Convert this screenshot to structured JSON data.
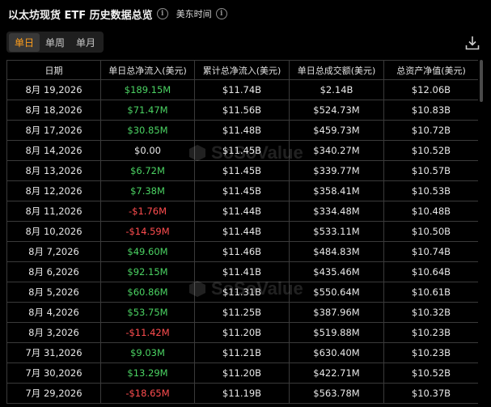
{
  "header": {
    "title": "以太坊现货 ETF 历史数据总览",
    "timezone_label": "美东时间"
  },
  "tabs": [
    {
      "label": "单日",
      "active": true
    },
    {
      "label": "单周",
      "active": false
    },
    {
      "label": "单月",
      "active": false
    }
  ],
  "watermark_text": "SoSoValue",
  "colors": {
    "accent": "#ff9f1c",
    "positive": "#4bd363",
    "negative": "#ff4d4f"
  },
  "table": {
    "columns": [
      "日期",
      "单日总净流入(美元)",
      "累计总净流入(美元)",
      "单日总成交额(美元)",
      "总资产净值(美元)"
    ],
    "rows": [
      {
        "date": "8月 19,2026",
        "daily_net_inflow": "$189.15M",
        "sign": "pos",
        "cumulative_net_inflow": "$11.74B",
        "daily_volume": "$2.14B",
        "net_assets": "$12.06B"
      },
      {
        "date": "8月 18,2026",
        "daily_net_inflow": "$71.47M",
        "sign": "pos",
        "cumulative_net_inflow": "$11.56B",
        "daily_volume": "$524.73M",
        "net_assets": "$10.83B"
      },
      {
        "date": "8月 17,2026",
        "daily_net_inflow": "$30.85M",
        "sign": "pos",
        "cumulative_net_inflow": "$11.48B",
        "daily_volume": "$459.73M",
        "net_assets": "$10.72B"
      },
      {
        "date": "8月 14,2026",
        "daily_net_inflow": "$0.00",
        "sign": "neutral",
        "cumulative_net_inflow": "$11.45B",
        "daily_volume": "$340.27M",
        "net_assets": "$10.52B"
      },
      {
        "date": "8月 13,2026",
        "daily_net_inflow": "$6.72M",
        "sign": "pos",
        "cumulative_net_inflow": "$11.45B",
        "daily_volume": "$339.77M",
        "net_assets": "$10.57B"
      },
      {
        "date": "8月 12,2026",
        "daily_net_inflow": "$7.38M",
        "sign": "pos",
        "cumulative_net_inflow": "$11.45B",
        "daily_volume": "$358.41M",
        "net_assets": "$10.53B"
      },
      {
        "date": "8月 11,2026",
        "daily_net_inflow": "-$1.76M",
        "sign": "neg",
        "cumulative_net_inflow": "$11.44B",
        "daily_volume": "$334.48M",
        "net_assets": "$10.48B"
      },
      {
        "date": "8月 10,2026",
        "daily_net_inflow": "-$14.59M",
        "sign": "neg",
        "cumulative_net_inflow": "$11.44B",
        "daily_volume": "$533.11M",
        "net_assets": "$10.50B"
      },
      {
        "date": "8月 7,2026",
        "daily_net_inflow": "$49.60M",
        "sign": "pos",
        "cumulative_net_inflow": "$11.46B",
        "daily_volume": "$484.83M",
        "net_assets": "$10.74B"
      },
      {
        "date": "8月 6,2026",
        "daily_net_inflow": "$92.15M",
        "sign": "pos",
        "cumulative_net_inflow": "$11.41B",
        "daily_volume": "$435.46M",
        "net_assets": "$10.64B"
      },
      {
        "date": "8月 5,2026",
        "daily_net_inflow": "$60.86M",
        "sign": "pos",
        "cumulative_net_inflow": "$11.31B",
        "daily_volume": "$550.64M",
        "net_assets": "$10.61B"
      },
      {
        "date": "8月 4,2026",
        "daily_net_inflow": "$53.75M",
        "sign": "pos",
        "cumulative_net_inflow": "$11.25B",
        "daily_volume": "$387.96M",
        "net_assets": "$10.32B"
      },
      {
        "date": "8月 3,2026",
        "daily_net_inflow": "-$11.42M",
        "sign": "neg",
        "cumulative_net_inflow": "$11.20B",
        "daily_volume": "$519.88M",
        "net_assets": "$10.23B"
      },
      {
        "date": "7月 31,2026",
        "daily_net_inflow": "$9.03M",
        "sign": "pos",
        "cumulative_net_inflow": "$11.21B",
        "daily_volume": "$630.40M",
        "net_assets": "$10.23B"
      },
      {
        "date": "7月 30,2026",
        "daily_net_inflow": "$13.29M",
        "sign": "pos",
        "cumulative_net_inflow": "$11.20B",
        "daily_volume": "$422.71M",
        "net_assets": "$10.52B"
      },
      {
        "date": "7月 29,2026",
        "daily_net_inflow": "-$18.65M",
        "sign": "neg",
        "cumulative_net_inflow": "$11.19B",
        "daily_volume": "$563.78M",
        "net_assets": "$10.37B"
      }
    ]
  }
}
